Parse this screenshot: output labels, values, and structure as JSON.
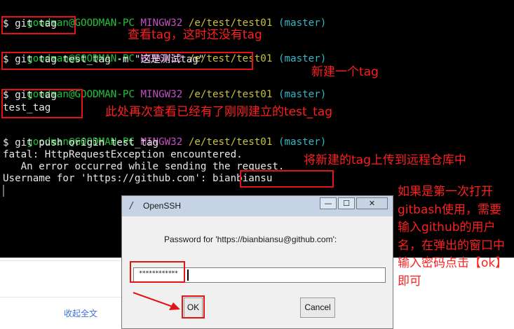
{
  "terminal": {
    "prompt1": {
      "user": "goodman@GOODMAN-PC",
      "shell": "MINGW32",
      "path": "/e/test/test01",
      "branch": "(master)"
    },
    "cmd1": "$ git tag",
    "prompt2": {
      "user": "goodman@GOODMAN-PC",
      "shell": "MINGW32",
      "path": "/e/test/test01",
      "branch": "(master)"
    },
    "cmd2": "$ git tag test_tag -m \"这是测试tag\"",
    "prompt3": {
      "user": "goodman@GOODMAN-PC",
      "shell": "MINGW32",
      "path": "/e/test/test01",
      "branch": "(master)"
    },
    "cmd3": "$ git tag",
    "out3": "test_tag",
    "prompt4": {
      "user": "goodman@GOODMAN-PC",
      "shell": "MINGW32",
      "path": "/e/test/test01",
      "branch": "(master)"
    },
    "cmd4": "$ git push origin test_tag",
    "out4_1": "fatal: HttpRequestException encountered.",
    "out4_2": "   An error occurred while sending the request.",
    "out4_3": "Username for 'https://github.com': ",
    "username": "bianbiansu"
  },
  "annotations": {
    "note1": "查看tag，这时还没有tag",
    "note2": "新建一个tag",
    "note3": "此处再次查看已经有了刚刚建立的test_tag",
    "note4": "将新建的tag上传到远程仓库中",
    "note5": "如果是第一次打开gitbash使用，需要输入github的用户名，在弹出的窗口中输入密码点击【ok】即可"
  },
  "page": {
    "collapse_label": "收起全文"
  },
  "dialog": {
    "title": "OpenSSH",
    "prompt": "Password for 'https://bianbiansu@github.com':",
    "password_value": "************",
    "ok_label": "OK",
    "cancel_label": "Cancel",
    "minimize_glyph": "—",
    "maximize_glyph": "☐",
    "close_glyph": "✕"
  },
  "colors": {
    "annotation": "#ff1f1f",
    "prompt_user": "#23c23a",
    "prompt_shell": "#c54fc3",
    "prompt_path": "#c9c13a",
    "prompt_branch": "#31b8c7"
  }
}
